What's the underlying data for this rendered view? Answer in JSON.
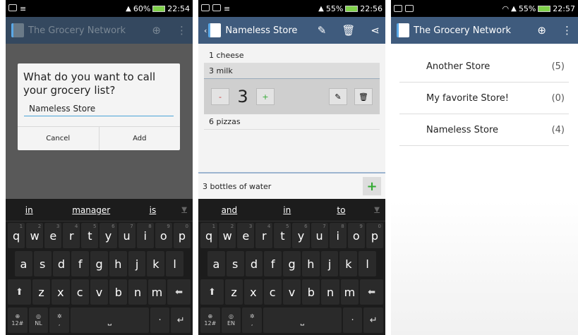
{
  "screen1": {
    "status": {
      "battery": "60%",
      "time": "22:54"
    },
    "app_title": "The Grocery Network",
    "dialog": {
      "question": "What do you want to call your grocery list?",
      "input_value": "Nameless Store",
      "cancel_label": "Cancel",
      "add_label": "Add"
    },
    "suggestions": [
      "in",
      "manager",
      "is"
    ],
    "bottom_row": {
      "k1": "12#",
      "k2": "NL",
      "k3": ","
    }
  },
  "screen2": {
    "status": {
      "battery": "55%",
      "time": "22:56"
    },
    "title": "Nameless Store",
    "items": [
      {
        "label": "1 cheese"
      },
      {
        "label": "3 milk"
      },
      {
        "label": "6 pizzas"
      }
    ],
    "editor": {
      "minus": "-",
      "quantity": "3",
      "plus": "+"
    },
    "new_item_value": "3 bottles of water",
    "add_symbol": "+",
    "suggestions": [
      "and",
      "in",
      "to"
    ],
    "bottom_row": {
      "k1": "12#",
      "k2": "EN",
      "k3": ","
    }
  },
  "screen3": {
    "status": {
      "battery": "55%",
      "time": "22:57"
    },
    "app_title": "The Grocery Network",
    "stores": [
      {
        "name": "Another Store",
        "count": "(5)"
      },
      {
        "name": "My favorite Store!",
        "count": "(0)"
      },
      {
        "name": "Nameless Store",
        "count": "(4)"
      }
    ]
  },
  "keyboard": {
    "row1": [
      "q",
      "w",
      "e",
      "r",
      "t",
      "y",
      "u",
      "i",
      "o",
      "p"
    ],
    "row1_sup": [
      "1",
      "2",
      "3",
      "4",
      "5",
      "6",
      "7",
      "8",
      "9",
      "0"
    ],
    "row2": [
      "a",
      "s",
      "d",
      "f",
      "g",
      "h",
      "j",
      "k",
      "l"
    ],
    "row3": [
      "z",
      "x",
      "c",
      "v",
      "b",
      "n",
      "m"
    ]
  }
}
